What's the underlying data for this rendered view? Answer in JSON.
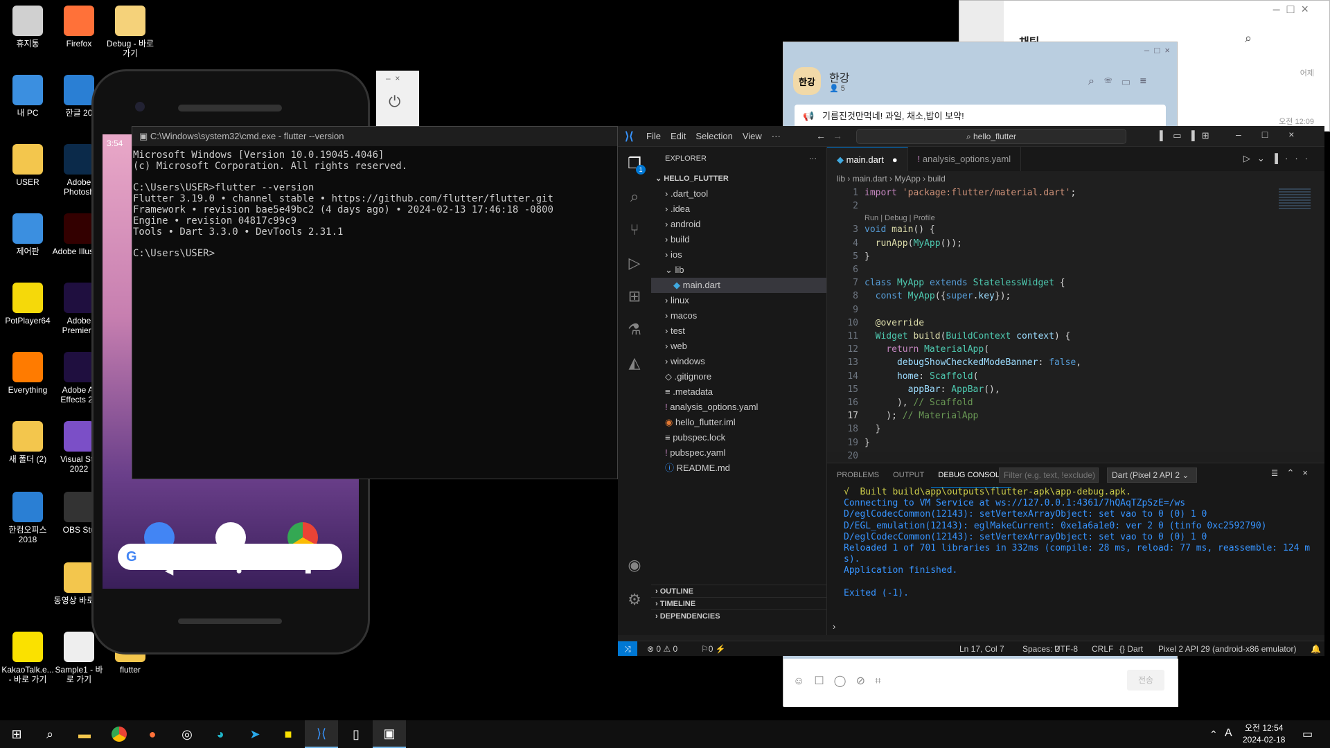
{
  "desktop": {
    "icons": [
      {
        "label": "휴지통",
        "icon": "recycle-bin-icon",
        "color": "#d0d0d0"
      },
      {
        "label": "Firefox",
        "icon": "firefox-icon",
        "color": "#ff7139"
      },
      {
        "label": "Debug - 바로 가기",
        "icon": "folder-shortcut-icon",
        "color": "#f5d27a"
      },
      {
        "label": "내 PC",
        "icon": "pc-icon",
        "color": "#3b8fe0"
      },
      {
        "label": "한글 20",
        "icon": "hangul-icon",
        "color": "#2a7fd4"
      },
      {
        "label": "USER",
        "icon": "user-folder-icon",
        "color": "#f3c64d"
      },
      {
        "label": "Adobe Photosh",
        "icon": "photoshop-icon",
        "color": "#0b2a4a"
      },
      {
        "label": "제어판",
        "icon": "control-panel-icon",
        "color": "#3b8fe0"
      },
      {
        "label": "Adobe Illustrat",
        "icon": "illustrator-icon",
        "color": "#330000"
      },
      {
        "label": "PotPlayer64",
        "icon": "potplayer-icon",
        "color": "#f5d90a"
      },
      {
        "label": "Adobe Premiere",
        "icon": "premiere-icon",
        "color": "#1f0f3f"
      },
      {
        "label": "Everything",
        "icon": "everything-icon",
        "color": "#ff7b00"
      },
      {
        "label": "Adobe Af Effects 20",
        "icon": "after-effects-icon",
        "color": "#1f0f3f"
      },
      {
        "label": "새 폴더 (2)",
        "icon": "folder-icon",
        "color": "#f3c64d"
      },
      {
        "label": "Visual Stu 2022",
        "icon": "visual-studio-icon",
        "color": "#7b4fc7"
      },
      {
        "label": "한컴오피스 2018",
        "icon": "hancom-icon",
        "color": "#2a7fd4"
      },
      {
        "label": "OBS Stu",
        "icon": "obs-icon",
        "color": "#333"
      },
      {
        "label": "동영상 바로 가",
        "icon": "video-shortcut-icon",
        "color": "#f3c64d"
      },
      {
        "label": "KakaoTalk.e... - 바로 가기",
        "icon": "kakaotalk-icon",
        "color": "#fae100"
      },
      {
        "label": "Sample1 - 바로 가기",
        "icon": "sample-shortcut-icon",
        "color": "#eee"
      },
      {
        "label": "flutter",
        "icon": "flutter-folder-icon",
        "color": "#f3c64d"
      }
    ]
  },
  "kakao": {
    "chat_title": "채팅",
    "room_name": "한강",
    "member_count": "5",
    "notice": "기름진것만먹네! 과일, 채소,밥이 보약!",
    "time1": "어제",
    "time2": "오전 12:09",
    "send_label": "전송",
    "avatar_text": "한강"
  },
  "phone": {
    "time": "3:54"
  },
  "cmd": {
    "title": "C:\\Windows\\system32\\cmd.exe - flutter  --version",
    "lines": "Microsoft Windows [Version 10.0.19045.4046]\n(c) Microsoft Corporation. All rights reserved.\n\nC:\\Users\\USER>flutter --version\nFlutter 3.19.0 • channel stable • https://github.com/flutter/flutter.git\nFramework • revision bae5e49bc2 (4 days ago) • 2024-02-13 17:46:18 -0800\nEngine • revision 04817c99c9\nTools • Dart 3.3.0 • DevTools 2.31.1\n\nC:\\Users\\USER>"
  },
  "vscode": {
    "menu": [
      "File",
      "Edit",
      "Selection",
      "View",
      "···"
    ],
    "search": "hello_flutter",
    "explorer_title": "EXPLORER",
    "root": "HELLO_FLUTTER",
    "tree": [
      {
        "name": ".dart_tool",
        "kind": "dir",
        "depth": 1
      },
      {
        "name": ".idea",
        "kind": "dir",
        "depth": 1
      },
      {
        "name": "android",
        "kind": "dir",
        "depth": 1
      },
      {
        "name": "build",
        "kind": "dir",
        "depth": 1
      },
      {
        "name": "ios",
        "kind": "dir",
        "depth": 1
      },
      {
        "name": "lib",
        "kind": "open",
        "depth": 1
      },
      {
        "name": "main.dart",
        "kind": "dart",
        "depth": 2,
        "selected": true
      },
      {
        "name": "linux",
        "kind": "dir",
        "depth": 1
      },
      {
        "name": "macos",
        "kind": "dir",
        "depth": 1
      },
      {
        "name": "test",
        "kind": "dir",
        "depth": 1
      },
      {
        "name": "web",
        "kind": "dir",
        "depth": 1
      },
      {
        "name": "windows",
        "kind": "dir",
        "depth": 1
      },
      {
        "name": ".gitignore",
        "kind": "git",
        "depth": 1
      },
      {
        "name": ".metadata",
        "kind": "file",
        "depth": 1
      },
      {
        "name": "analysis_options.yaml",
        "kind": "yaml",
        "depth": 1
      },
      {
        "name": "hello_flutter.iml",
        "kind": "rss",
        "depth": 1
      },
      {
        "name": "pubspec.lock",
        "kind": "file",
        "depth": 1
      },
      {
        "name": "pubspec.yaml",
        "kind": "yaml",
        "depth": 1
      },
      {
        "name": "README.md",
        "kind": "info",
        "depth": 1
      }
    ],
    "sections": [
      "OUTLINE",
      "TIMELINE",
      "DEPENDENCIES"
    ],
    "tabs": [
      {
        "label": "main.dart",
        "active": true,
        "dirty": true
      },
      {
        "label": "analysis_options.yaml",
        "active": false
      }
    ],
    "breadcrumb": [
      "lib",
      "main.dart",
      "MyApp",
      "build"
    ],
    "codelens": "Run | Debug | Profile",
    "code": [
      {
        "n": "1",
        "html": "<span style='color:#c586c0'>import</span> <span style='color:#ce9178'>'package:flutter/material.dart'</span>;"
      },
      {
        "n": "2",
        "html": ""
      },
      {
        "n": "3",
        "html": "<span style='color:#569cd6'>void</span> <span style='color:#dcdcaa'>main</span>() {"
      },
      {
        "n": "4",
        "html": "  <span style='color:#dcdcaa'>runApp</span>(<span style='color:#4ec9b0'>MyApp</span>());"
      },
      {
        "n": "5",
        "html": "}"
      },
      {
        "n": "6",
        "html": ""
      },
      {
        "n": "7",
        "html": "<span style='color:#569cd6'>class</span> <span style='color:#4ec9b0'>MyApp</span> <span style='color:#569cd6'>extends</span> <span style='color:#4ec9b0'>StatelessWidget</span> {"
      },
      {
        "n": "8",
        "html": "  <span style='color:#569cd6'>const</span> <span style='color:#4ec9b0'>MyApp</span>({<span style='color:#569cd6'>super</span>.<span style='color:#9cdcfe'>key</span>});"
      },
      {
        "n": "9",
        "html": ""
      },
      {
        "n": "10",
        "html": "  <span style='color:#dcdcaa'>@override</span>"
      },
      {
        "n": "11",
        "html": "  <span style='color:#4ec9b0'>Widget</span> <span style='color:#dcdcaa'>build</span>(<span style='color:#4ec9b0'>BuildContext</span> <span style='color:#9cdcfe'>context</span>) {"
      },
      {
        "n": "12",
        "html": "    <span style='color:#c586c0'>return</span> <span style='color:#4ec9b0'>MaterialApp</span>("
      },
      {
        "n": "13",
        "html": "      <span style='color:#9cdcfe'>debugShowCheckedModeBanner</span>: <span style='color:#569cd6'>false</span>,"
      },
      {
        "n": "14",
        "html": "      <span style='color:#9cdcfe'>home</span>: <span style='color:#4ec9b0'>Scaffold</span>("
      },
      {
        "n": "15",
        "html": "        <span style='color:#9cdcfe'>appBar</span>: <span style='color:#4ec9b0'>AppBar</span>(),"
      },
      {
        "n": "16",
        "html": "      ), <span style='color:#6a9955'>// Scaffold</span>"
      },
      {
        "n": "17",
        "html": "    ); <span style='color:#6a9955'>// MaterialApp</span>"
      },
      {
        "n": "18",
        "html": "  }"
      },
      {
        "n": "19",
        "html": "}"
      },
      {
        "n": "20",
        "html": ""
      }
    ],
    "panel_tabs": [
      "PROBLEMS",
      "OUTPUT",
      "DEBUG CONSOLE"
    ],
    "filter_placeholder": "Filter (e.g. text, !exclude)",
    "device_select": "Dart (Pixel 2 API 2",
    "console": [
      {
        "t": "√  Built build\\app\\outputs\\flutter-apk\\app-debug.apk.",
        "c": "#cccc4a"
      },
      {
        "t": "Connecting to VM Service at ws://127.0.0.1:4361/7hQAqTZpSzE=/ws",
        "c": "#3794ff"
      },
      {
        "t": "D/eglCodecCommon(12143): setVertexArrayObject: set vao to 0 (0) 1 0",
        "c": "#3794ff"
      },
      {
        "t": "D/EGL_emulation(12143): eglMakeCurrent: 0xe1a6a1e0: ver 2 0 (tinfo 0xc2592790)",
        "c": "#3794ff"
      },
      {
        "t": "D/eglCodecCommon(12143): setVertexArrayObject: set vao to 0 (0) 1 0",
        "c": "#3794ff"
      },
      {
        "t": "Reloaded 1 of 701 libraries in 332ms (compile: 28 ms, reload: 77 ms, reassemble: 124 m",
        "c": "#3794ff"
      },
      {
        "t": "s).",
        "c": "#3794ff"
      },
      {
        "t": "Application finished.",
        "c": "#3794ff"
      },
      {
        "t": "",
        "c": "#3794ff"
      },
      {
        "t": "Exited (-1).",
        "c": "#3794ff"
      }
    ],
    "status": {
      "errors": "0",
      "warnings": "0",
      "ports": "0",
      "position": "Ln 17, Col 7",
      "spaces": "Spaces: 2",
      "encoding": "UTF-8",
      "eol": "CRLF",
      "lang": "Dart",
      "device": "Pixel 2 API 29 (android-x86 emulator)"
    },
    "badge": "1"
  },
  "taskbar": {
    "time": "오전 12:54",
    "date": "2024-02-18",
    "ime": "A"
  }
}
